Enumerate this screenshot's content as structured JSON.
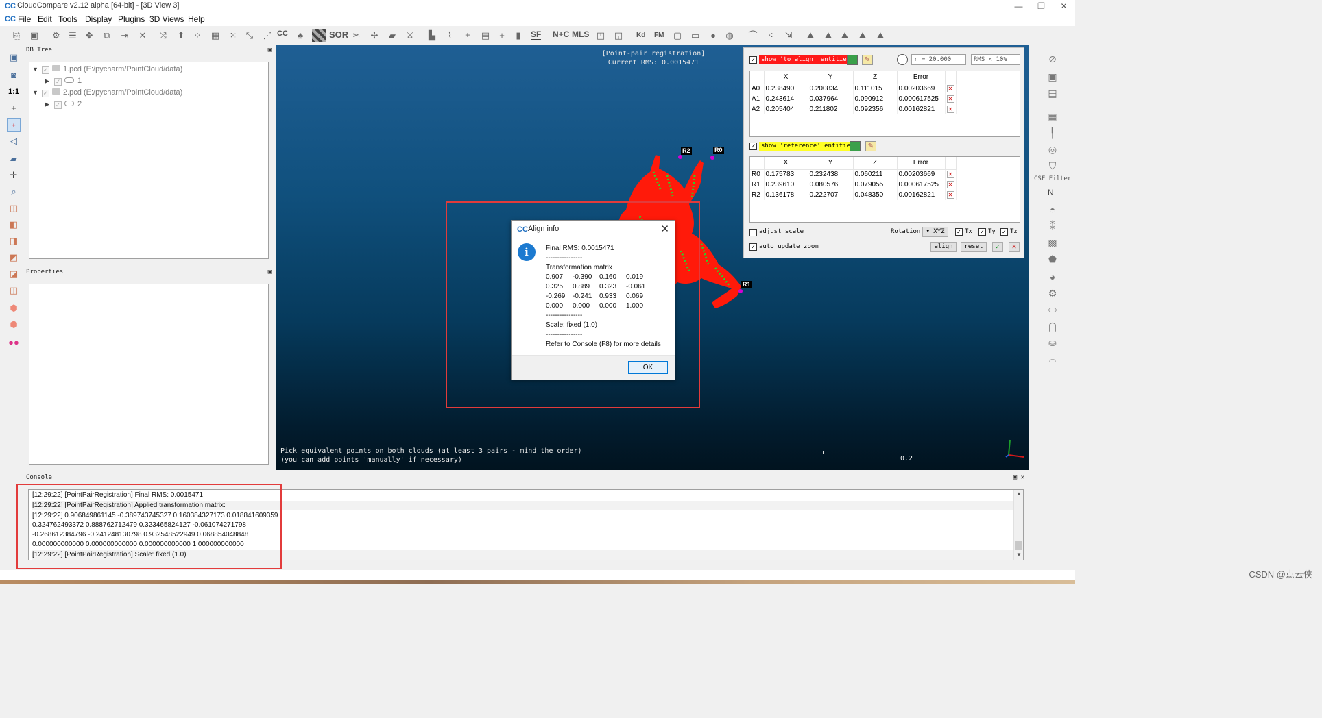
{
  "window": {
    "title": "CloudCompare v2.12 alpha [64-bit] - [3D View 3]",
    "controls": [
      "—",
      "❐",
      "✕"
    ]
  },
  "menu": [
    "File",
    "Edit",
    "Tools",
    "Display",
    "Plugins",
    "3D Views",
    "Help"
  ],
  "toolbar": {
    "sor_label": "SOR",
    "sf_label": "SF",
    "cc_label": "CC",
    "nc_label": "N+C",
    "mls_label": "MLS",
    "kd_label": "Kd",
    "fm_label": "FM"
  },
  "dbtree": {
    "title": "DB Tree",
    "items": [
      {
        "label": "1.pcd (E:/pycharm/PointCloud/data)"
      },
      {
        "label": "1"
      },
      {
        "label": "2.pcd (E:/pycharm/PointCloud/data)"
      },
      {
        "label": "2"
      }
    ]
  },
  "properties": {
    "title": "Properties"
  },
  "view": {
    "overlay_title": "[Point-pair registration]",
    "overlay_rms": "Current RMS: 0.0015471",
    "hint_line1": "Pick equivalent points on both clouds (at least 3 pairs - mind the order)",
    "hint_line2": "(you can add points 'manually' if necessary)",
    "scale_label": "0.2",
    "markers": [
      "R2",
      "R0",
      "R1"
    ]
  },
  "dialog": {
    "title": "Align info",
    "final_rms": "Final RMS: 0.0015471",
    "sep": "----------------",
    "matrix_title": "Transformation matrix",
    "matrix": [
      [
        "0.907",
        "-0.390",
        "0.160",
        "0.019"
      ],
      [
        "0.325",
        "0.889",
        "0.323",
        "-0.061"
      ],
      [
        "-0.269",
        "-0.241",
        "0.933",
        "0.069"
      ],
      [
        "0.000",
        "0.000",
        "0.000",
        "1.000"
      ]
    ],
    "scale": "Scale: fixed (1.0)",
    "refer": "Refer to Console (F8) for more details",
    "ok_label": "OK"
  },
  "registration": {
    "align_label": "show 'to align' entities",
    "reference_label": "show 'reference' entities",
    "radius": "r = 20.000",
    "rms_filter": "RMS < 10%",
    "headers": [
      "X",
      "Y",
      "Z",
      "Error"
    ],
    "align_rows": [
      {
        "id": "A0",
        "x": "0.238490",
        "y": "0.200834",
        "z": "0.111015",
        "err": "0.00203669"
      },
      {
        "id": "A1",
        "x": "0.243614",
        "y": "0.037964",
        "z": "0.090912",
        "err": "0.000617525"
      },
      {
        "id": "A2",
        "x": "0.205404",
        "y": "0.211802",
        "z": "0.092356",
        "err": "0.00162821"
      }
    ],
    "reference_rows": [
      {
        "id": "R0",
        "x": "0.175783",
        "y": "0.232438",
        "z": "0.060211",
        "err": "0.00203669"
      },
      {
        "id": "R1",
        "x": "0.239610",
        "y": "0.080576",
        "z": "0.079055",
        "err": "0.000617525"
      },
      {
        "id": "R2",
        "x": "0.136178",
        "y": "0.222707",
        "z": "0.048350",
        "err": "0.00162821"
      }
    ],
    "adjust_scale": "adjust scale",
    "auto_update_zoom": "auto update zoom",
    "rotation_label": "Rotation",
    "rotation_value": "XYZ",
    "tx": "Tx",
    "ty": "Ty",
    "tz": "Tz",
    "align_btn": "align",
    "reset_btn": "reset"
  },
  "right_toolbar": {
    "csf_label": "CSF Filter",
    "n_label": "N"
  },
  "console": {
    "title": "Console",
    "lines": [
      "[12:29:22] [PointPairRegistration] Final RMS: 0.0015471",
      "[12:29:22] [PointPairRegistration] Applied transformation matrix:",
      "[12:29:22] 0.906849861145 -0.389743745327 0.160384327173 0.018841609359",
      "0.324762493372 0.888762712479 0.323465824127 -0.061074271798",
      "-0.268612384796 -0.241248130798 0.932548522949 0.068854048848",
      "0.000000000000 0.000000000000 0.000000000000 1.000000000000",
      "[12:29:22] [PointPairRegistration] Scale: fixed (1.0)"
    ]
  },
  "watermark": "CSDN @点云侠",
  "colors": {
    "accent_red": "#e23b3b",
    "cloud_red": "#ff1a0a",
    "cloud_green": "#2bd12b",
    "info_blue": "#1c7ad0"
  }
}
